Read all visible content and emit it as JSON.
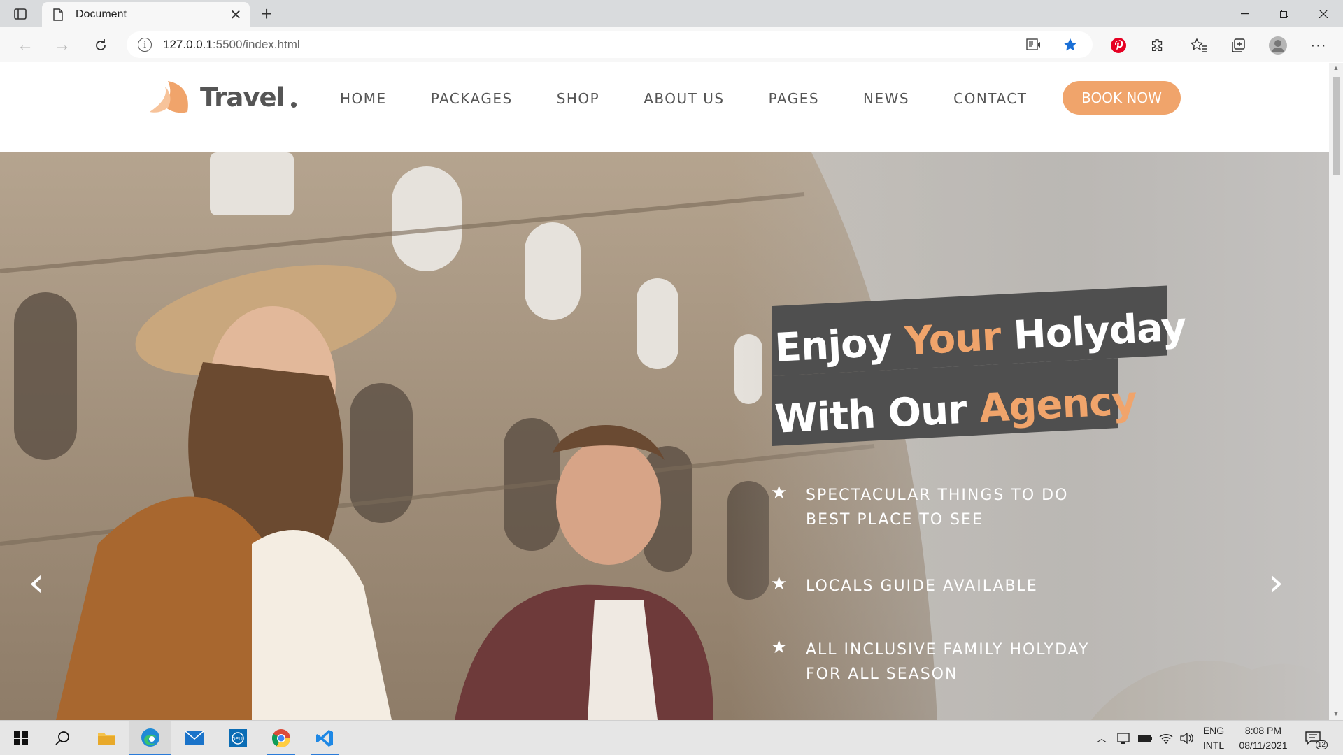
{
  "browser": {
    "tab_title": "Document",
    "url_host": "127.0.0.1",
    "url_rest": ":5500/index.html",
    "new_tab_label": "+",
    "close_tab_label": "✕"
  },
  "site": {
    "logo_text": "Travel",
    "nav": [
      "HOME",
      "PACKAGES",
      "SHOP",
      "ABOUT US",
      "PAGES",
      "NEWS",
      "CONTACT"
    ],
    "book_button": "BOOK NOW",
    "accent_color": "#f0a46b"
  },
  "hero": {
    "headline_line1": {
      "a": "Enjoy ",
      "b": "Your",
      "c": " Holyday"
    },
    "headline_line2": {
      "a": "With Our ",
      "b": "Agency"
    },
    "features": [
      [
        "SPECTACULAR THINGS TO DO",
        "BEST PLACE TO SEE"
      ],
      [
        "LOCALS GUIDE AVAILABLE"
      ],
      [
        "ALL INCLUSIVE FAMILY HOLYDAY",
        "FOR ALL SEASON"
      ]
    ],
    "prev_arrow": "‹",
    "next_arrow": "›"
  },
  "taskbar": {
    "language_top": "ENG",
    "language_bottom": "INTL",
    "time": "8:08 PM",
    "date": "08/11/2021",
    "notification_count": "12"
  }
}
